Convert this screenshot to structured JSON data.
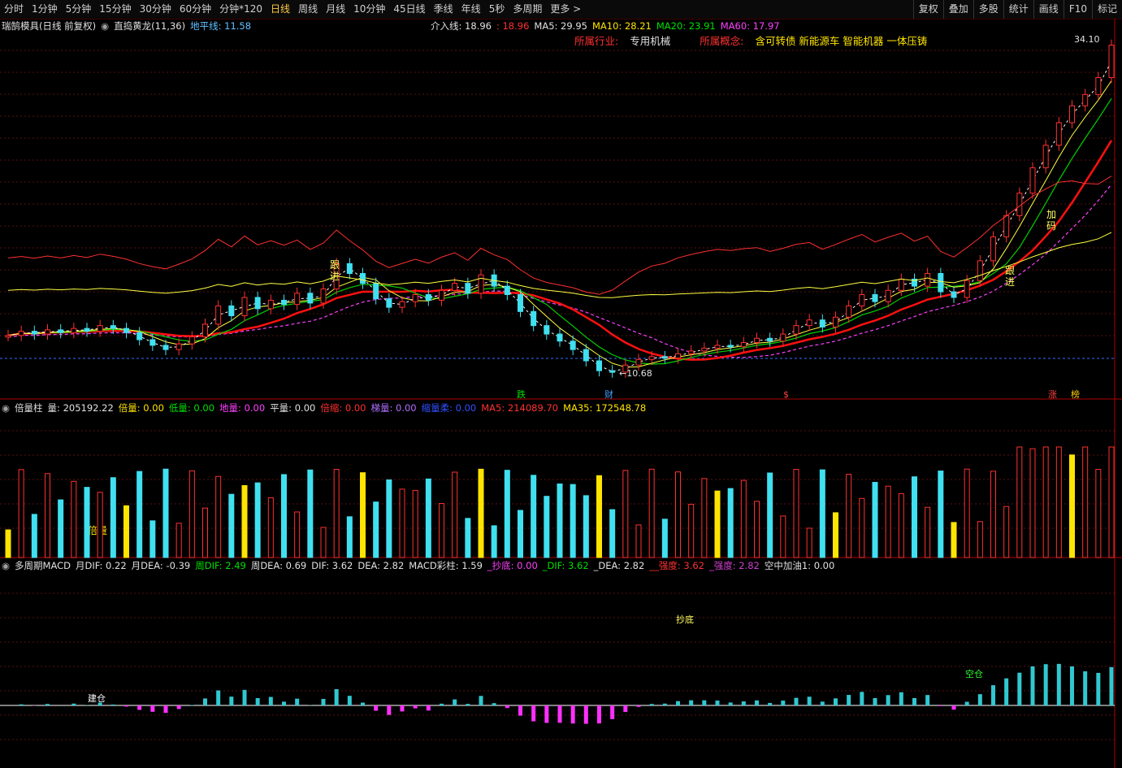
{
  "toolbar": {
    "periods": [
      "分时",
      "1分钟",
      "5分钟",
      "15分钟",
      "30分钟",
      "60分钟",
      "分钟*120",
      "日线",
      "周线",
      "月线",
      "10分钟",
      "45日线",
      "季线",
      "年线",
      "5秒",
      "多周期",
      "更多"
    ],
    "active": "日线",
    "more_suffix": ">",
    "right_buttons": [
      "复权",
      "叠加",
      "多股",
      "统计",
      "画线",
      "F10",
      "标记"
    ]
  },
  "main_info": {
    "stock": "瑞鹄模具(日线 前复权)",
    "indicator": "直捣黄龙(11,36)",
    "baseline_label": "地平线: 11.58",
    "entry_label": "介入线: 18.96",
    "entry_value2": ": 18.96",
    "ma5": "MA5: 29.95",
    "ma10": "MA10: 28.21",
    "ma20": "MA20: 23.91",
    "ma60": "MA60: 17.97"
  },
  "industry": {
    "industry_label": "所属行业:",
    "industry_value": "专用机械",
    "concept_label": "所属概念:",
    "concept_value": "含可转债 新能源车 智能机器 一体压铸"
  },
  "price_labels": {
    "high": "34.10",
    "low": "←10.68"
  },
  "main_annotations": [
    "跟进",
    "跟进",
    "加码"
  ],
  "event_markers": [
    "跌",
    "财",
    "$",
    "涨",
    "榜"
  ],
  "volume_info": {
    "name": "倍量柱",
    "vol": "量: 205192.22",
    "double": "倍量: 0.00",
    "low": "低量: 0.00",
    "ground": "地量: 0.00",
    "flat": "平量: 0.00",
    "shrink": "倍缩: 0.00",
    "ladder": "梯量: 0.00",
    "reduce": "缩量柔: 0.00",
    "ma5": "MA5: 214089.70",
    "ma35": "MA35: 172548.78"
  },
  "volume_annotation": "倍量",
  "macd_info": {
    "name": "多周期MACD",
    "m_dif": "月DIF: 0.22",
    "m_dea": "月DEA: -0.39",
    "w_dif": "周DIF: 2.49",
    "w_dea": "周DEA: 0.69",
    "dif": "DIF: 3.62",
    "dea": "DEA: 2.82",
    "bar": "MACD彩柱: 1.59",
    "bottom": "_抄底: 0.00",
    "dif2": "_DIF: 3.62",
    "dea2": "_DEA: 2.82",
    "strong": "__强度: 3.62",
    "strength": "_强度: 2.82",
    "air": "空中加油1: 0.00"
  },
  "macd_annotations": {
    "build": "建仓",
    "bottom": "抄底",
    "empty": "空仓"
  },
  "colors": {
    "up": "#ff3030",
    "down": "#40e0f0",
    "ma5": "#ffffff",
    "ma10": "#ffff40",
    "ma20": "#00d000",
    "ma60": "#ff40ff",
    "ma_red": "#ff1010",
    "ma_blue": "#2040ff"
  },
  "chart_data": {
    "type": "candlestick",
    "closes": [
      13.5,
      13.8,
      13.6,
      13.9,
      13.7,
      14.0,
      13.8,
      14.2,
      14.0,
      13.7,
      13.2,
      12.8,
      12.5,
      12.9,
      13.4,
      14.3,
      15.6,
      14.9,
      16.2,
      15.4,
      16.0,
      15.7,
      16.5,
      15.8,
      16.8,
      18.6,
      17.9,
      17.2,
      16.1,
      15.5,
      15.9,
      16.4,
      16.0,
      16.7,
      17.2,
      16.5,
      17.8,
      17.0,
      16.4,
      15.2,
      14.2,
      13.6,
      13.1,
      12.5,
      11.7,
      11.0,
      10.9,
      11.4,
      11.8,
      12.0,
      11.9,
      12.2,
      12.4,
      12.6,
      12.8,
      12.7,
      13.0,
      13.3,
      13.1,
      13.6,
      14.2,
      14.6,
      14.1,
      14.8,
      15.6,
      16.4,
      15.9,
      16.7,
      17.5,
      17.0,
      17.9,
      16.6,
      16.2,
      17.4,
      18.8,
      20.5,
      22.0,
      23.6,
      25.4,
      27.0,
      28.6,
      29.8,
      30.6,
      31.8,
      34.1
    ],
    "price_high": 34.1,
    "price_low": 10.68,
    "baseline": 11.58,
    "entry_line": 18.96,
    "ma5": 29.95,
    "ma10": 28.21,
    "ma20": 23.91,
    "ma60": 17.97
  }
}
